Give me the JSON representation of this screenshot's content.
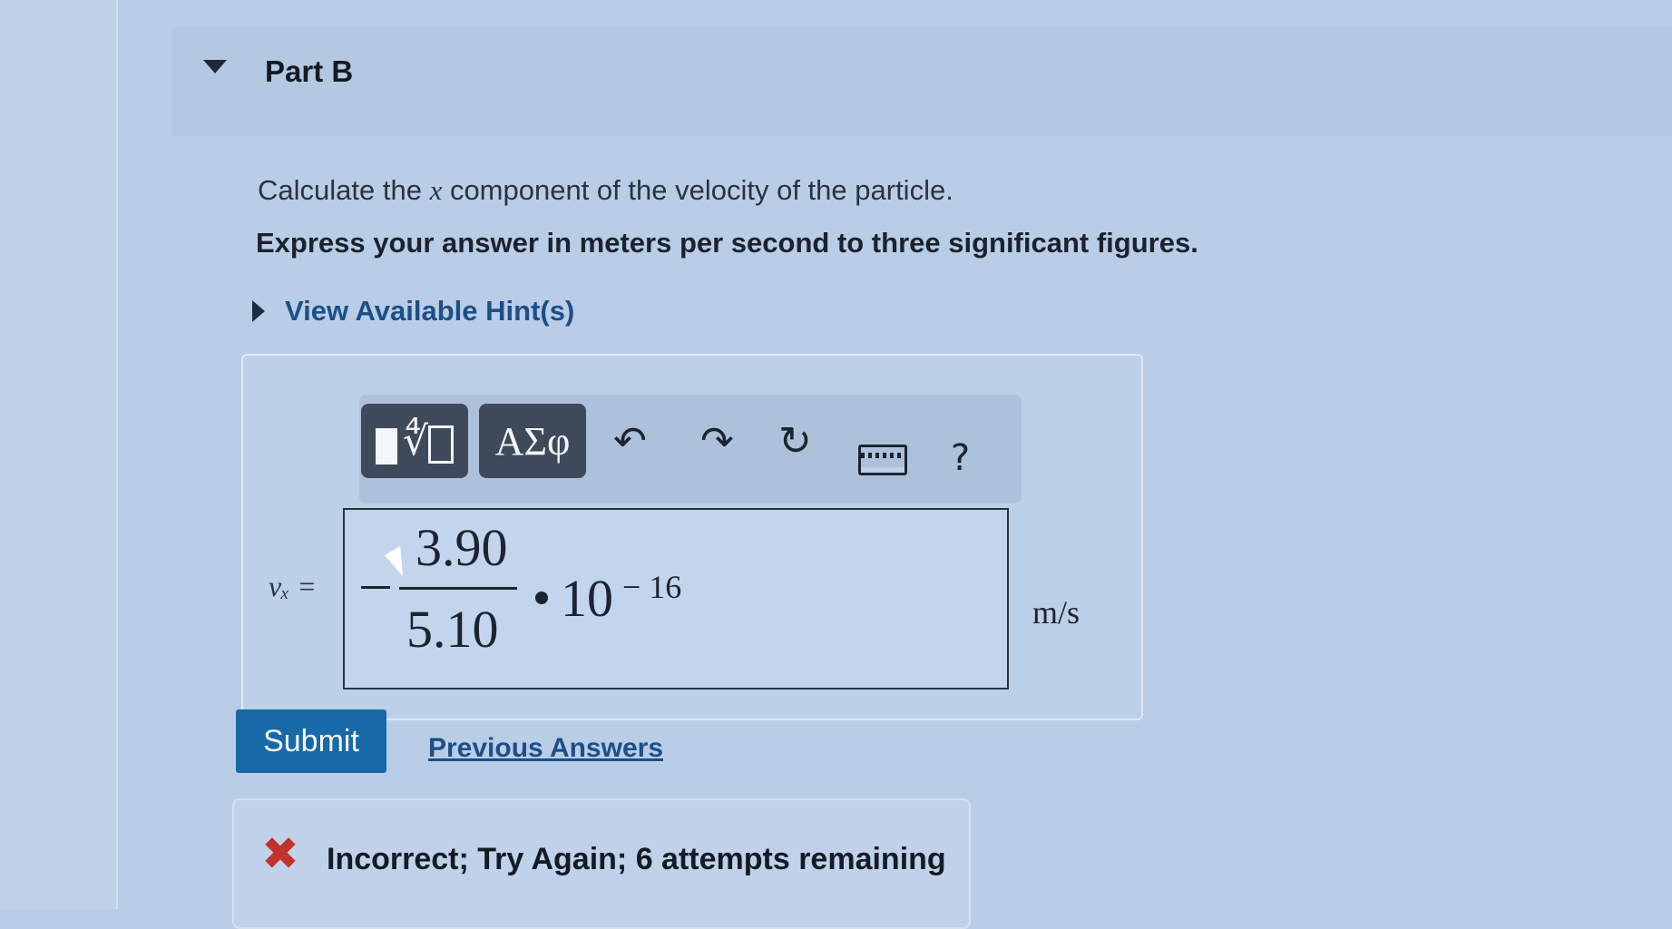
{
  "part": {
    "title": "Part B"
  },
  "question": {
    "text_before": "Calculate the ",
    "variable": "x",
    "text_after": " component of the velocity of the particle.",
    "instruction": "Express your answer in meters per second to three significant figures."
  },
  "hints": {
    "label": "View Available Hint(s)"
  },
  "toolbar": {
    "greek_label": "ΑΣφ",
    "radical_glyph": "∜",
    "undo_glyph": "↶",
    "redo_glyph": "↷",
    "reset_glyph": "↻",
    "help_label": "?"
  },
  "answer": {
    "variable_label": "vₓ =",
    "numerator": "3.90",
    "denominator": "5.10",
    "base": "10",
    "exponent": "− 16",
    "unit": "m/s"
  },
  "actions": {
    "submit_label": "Submit",
    "previous_answers_label": "Previous Answers"
  },
  "feedback": {
    "icon": "✖",
    "message": "Incorrect; Try Again; 6 attempts remaining",
    "color": "#c0332b"
  }
}
